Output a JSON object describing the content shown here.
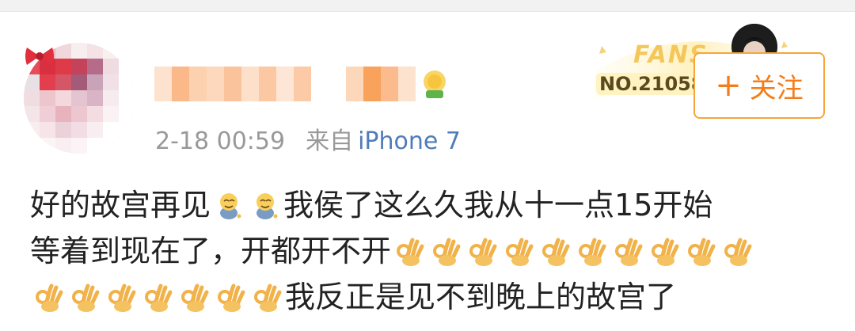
{
  "post": {
    "timestamp": "2-18 00:59",
    "source_prefix": "来自",
    "device": "iPhone 7",
    "line1_a": "好的故宫再见",
    "line1_b": "我侯了这么久我从十一点15开始",
    "line2": "等着到现在了，开都开不开",
    "line3": "我反正是见不到晚上的故宫了"
  },
  "fans_badge": {
    "word": "FANS",
    "number": "NO.21058"
  },
  "follow_button": {
    "plus": "+",
    "label": "关注"
  },
  "icons": {
    "emoji_a": "sweat-smile-icon",
    "emoji_b": "ok-hand-icon"
  },
  "colors": {
    "accent_orange": "#f37d1a",
    "link_blue": "#4f7cb8",
    "meta_gray": "#999999"
  }
}
